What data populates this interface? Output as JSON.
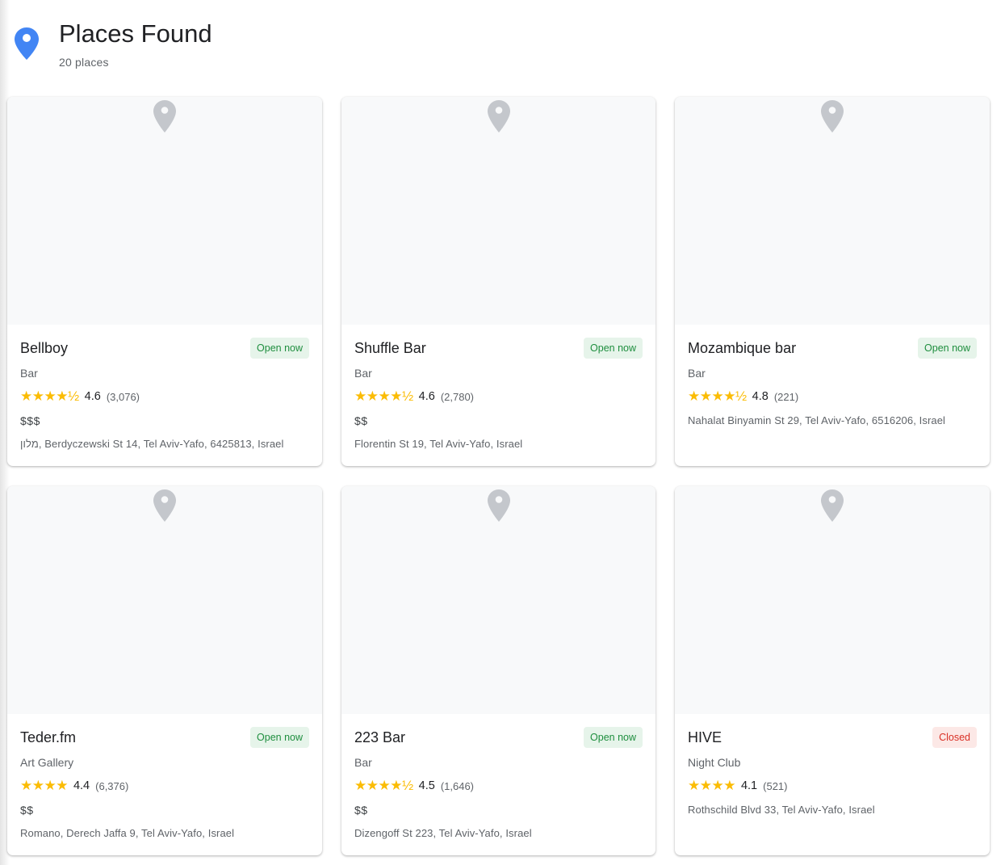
{
  "header": {
    "title": "Places Found",
    "count_text": "20 places",
    "pin_color": "#4285f4"
  },
  "colors": {
    "star": "#fbbc04",
    "open_bg": "#e6f4ea",
    "open_text": "#1e8e3e",
    "closed_bg": "#fce8e6",
    "closed_text": "#d93025",
    "image_placeholder": "#f8f9fa",
    "placeholder_pin": "#c4c7cc"
  },
  "places": [
    {
      "name": "Bellboy",
      "status": "Open now",
      "status_kind": "open",
      "type": "Bar",
      "stars": "★★★★½",
      "rating": "4.6",
      "reviews": "(3,076)",
      "price": "$$$",
      "address": "מלון, Berdyczewski St 14, Tel Aviv-Yafo, 6425813, Israel",
      "image_icon": "map-pin-icon"
    },
    {
      "name": "Shuffle Bar",
      "status": "Open now",
      "status_kind": "open",
      "type": "Bar",
      "stars": "★★★★½",
      "rating": "4.6",
      "reviews": "(2,780)",
      "price": "$$",
      "address": "Florentin St 19, Tel Aviv-Yafo, Israel",
      "image_icon": "map-pin-icon"
    },
    {
      "name": "Mozambique bar",
      "status": "Open now",
      "status_kind": "open",
      "type": "Bar",
      "stars": "★★★★½",
      "rating": "4.8",
      "reviews": "(221)",
      "price": null,
      "address": "Nahalat Binyamin St 29, Tel Aviv-Yafo, 6516206, Israel",
      "image_icon": "map-pin-icon"
    },
    {
      "name": "Teder.fm",
      "status": "Open now",
      "status_kind": "open",
      "type": "Art Gallery",
      "stars": "★★★★",
      "rating": "4.4",
      "reviews": "(6,376)",
      "price": "$$",
      "address": "Romano, Derech Jaffa 9, Tel Aviv-Yafo, Israel",
      "image_icon": "map-pin-icon"
    },
    {
      "name": "223 Bar",
      "status": "Open now",
      "status_kind": "open",
      "type": "Bar",
      "stars": "★★★★½",
      "rating": "4.5",
      "reviews": "(1,646)",
      "price": "$$",
      "address": "Dizengoff St 223, Tel Aviv-Yafo, Israel",
      "image_icon": "map-pin-icon"
    },
    {
      "name": "HIVE",
      "status": "Closed",
      "status_kind": "closed",
      "type": "Night Club",
      "stars": "★★★★",
      "rating": "4.1",
      "reviews": "(521)",
      "price": null,
      "address": "Rothschild Blvd 33, Tel Aviv-Yafo, Israel",
      "image_icon": "map-pin-icon"
    }
  ]
}
